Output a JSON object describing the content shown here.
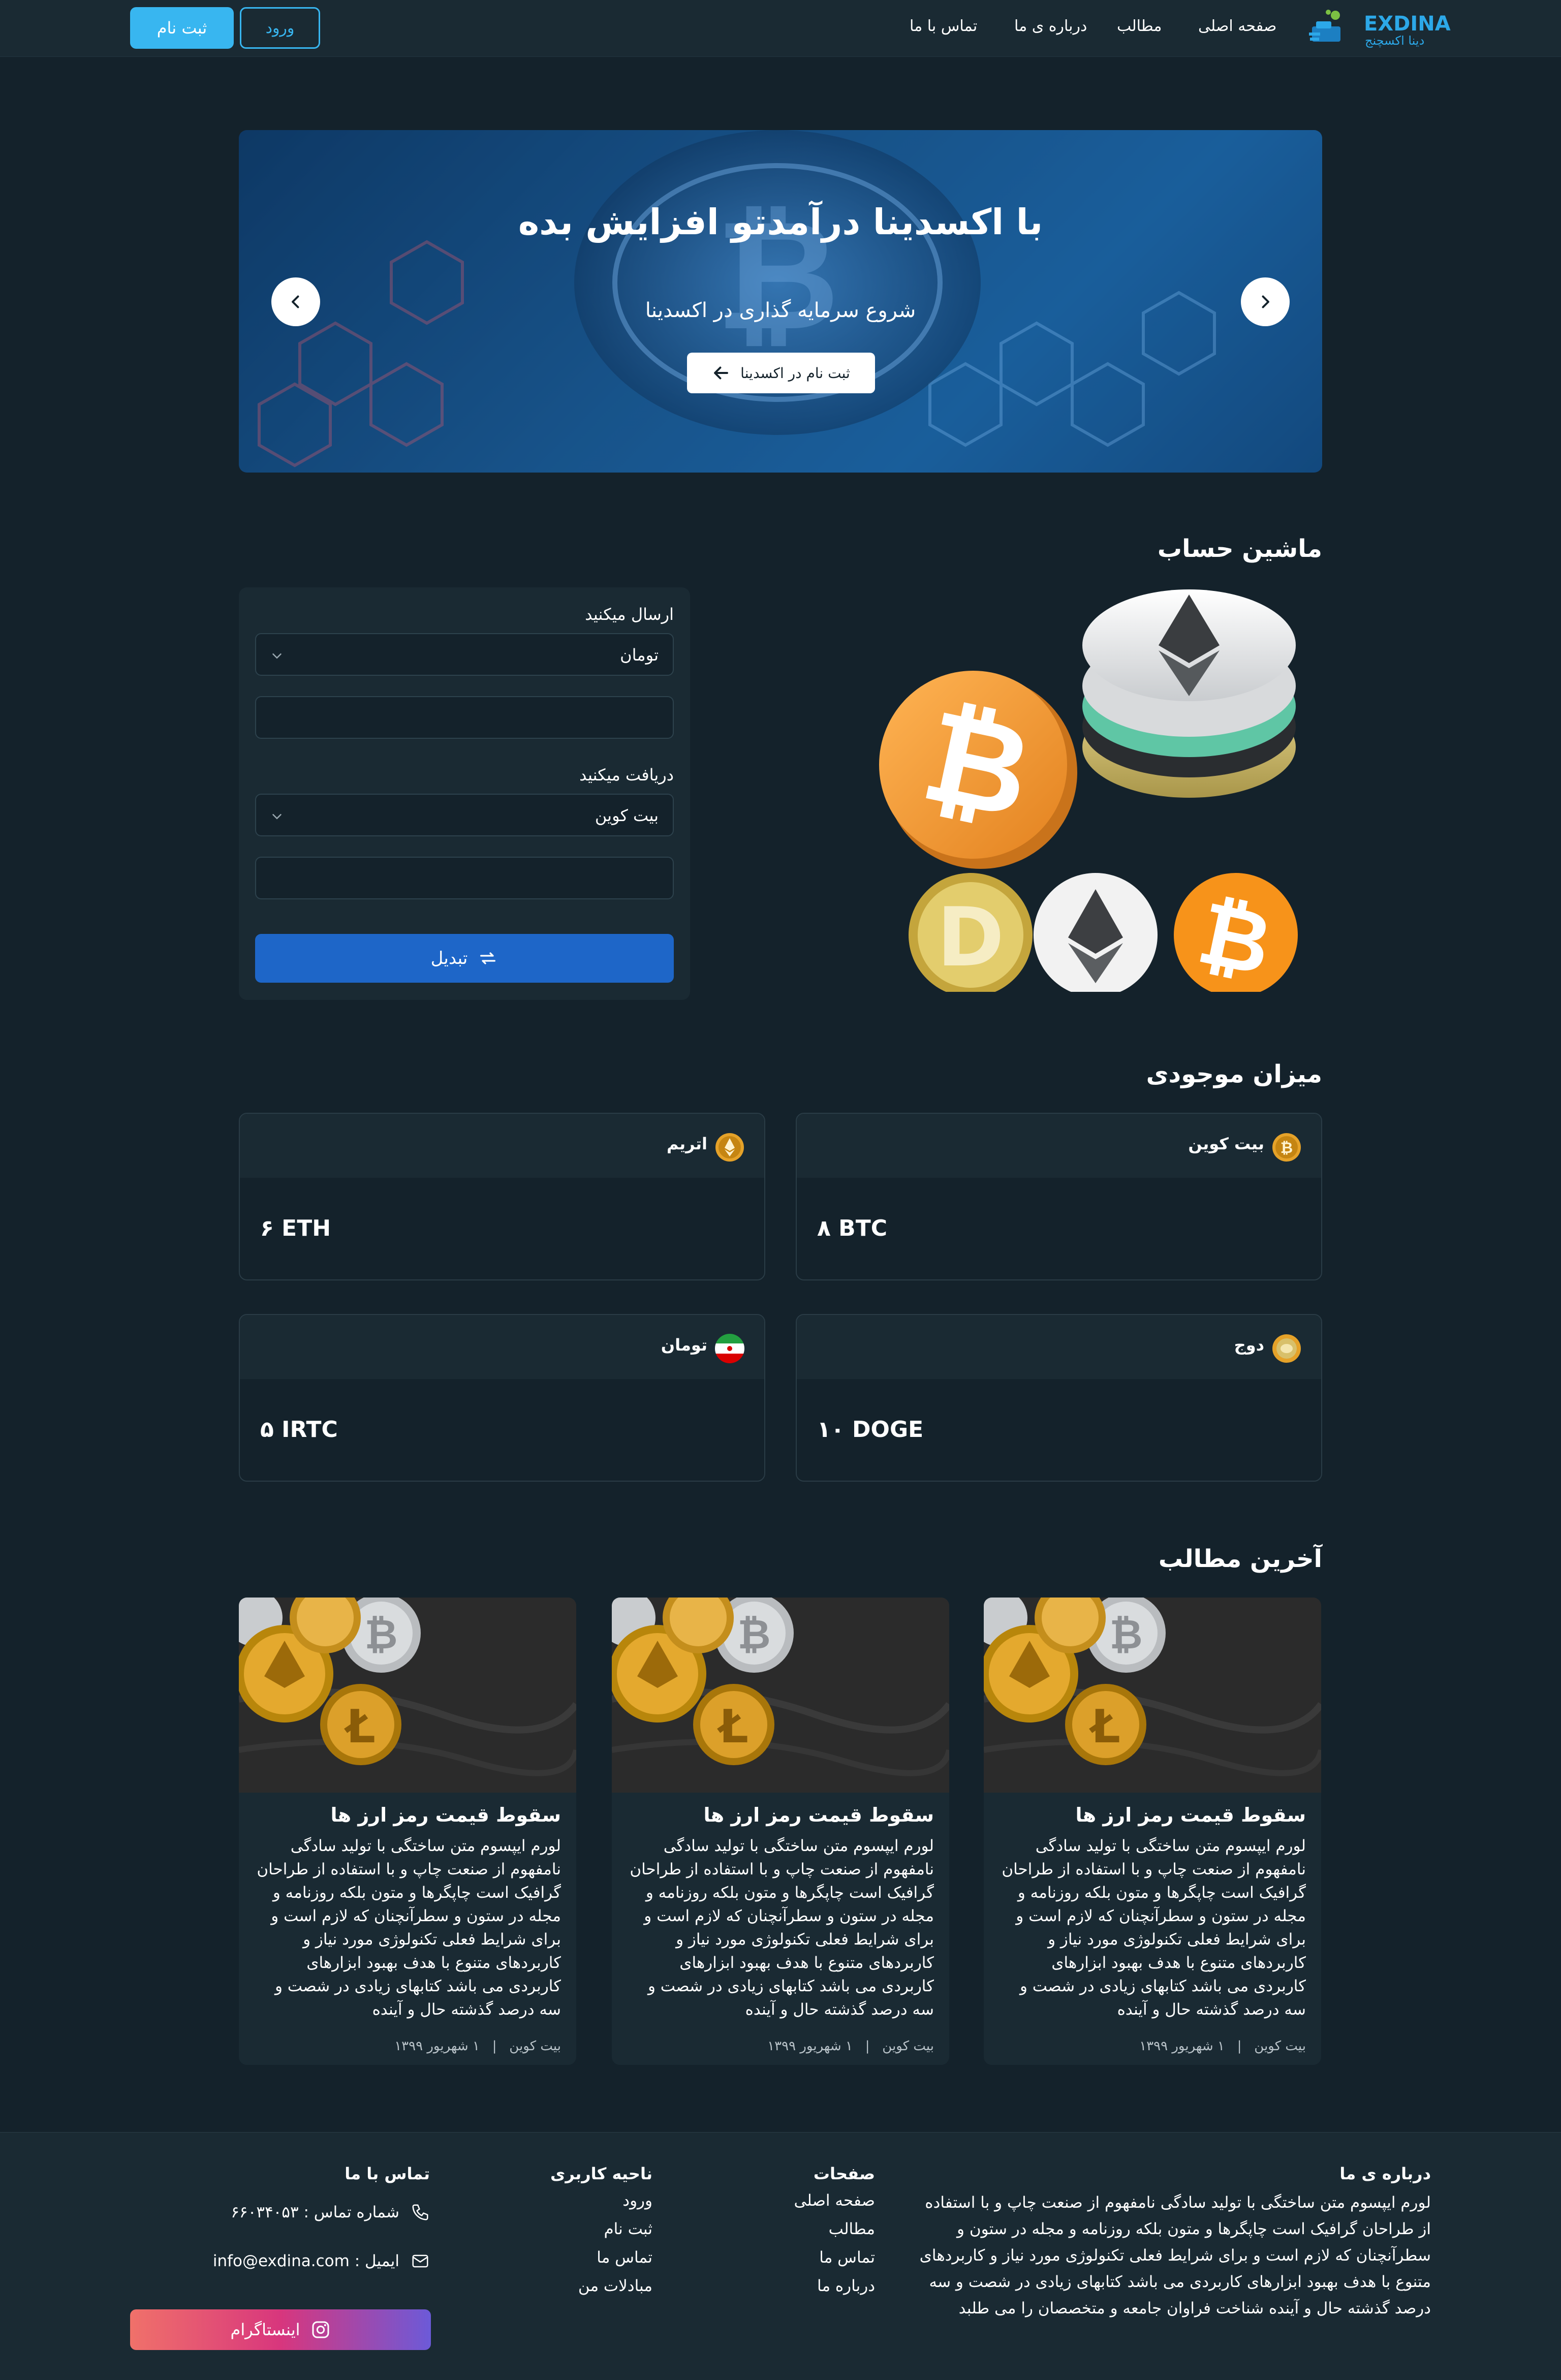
{
  "header": {
    "logo_text": "EXDINA",
    "logo_sub": "دینا اکسچنج",
    "nav": [
      "صفحه اصلی",
      "مطالب",
      "درباره ی ما",
      "تماس با ما"
    ],
    "login_label": "ورود",
    "signup_label": "ثبت نام"
  },
  "hero": {
    "title": "با اکسدینا درآمدتو افزایش بده",
    "subtitle": "شروع سرمایه گذاری در اکسدینا",
    "cta_label": "ثبت نام در اکسدینا"
  },
  "calculator": {
    "title": "ماشین حساب",
    "send_label": "ارسال میکنید",
    "send_value": "تومان",
    "send_amount": "",
    "receive_label": "دریافت میکنید",
    "receive_value": "بیت کوین",
    "receive_amount": "",
    "convert_label": "تبدیل"
  },
  "balances": {
    "title": "میزان موجودی",
    "items": [
      {
        "name": "بیت کوین",
        "amount": "۸ BTC"
      },
      {
        "name": "اتریم",
        "amount": "۶ ETH"
      },
      {
        "name": "دوج",
        "amount": "۱۰ DOGE"
      },
      {
        "name": "تومان",
        "amount": "۵ IRTC"
      }
    ]
  },
  "articles": {
    "title": "آخرین مطالب",
    "items": [
      {
        "title": "سقوط قیمت رمز ارز ها",
        "body": "لورم ایپسوم متن ساختگی با تولید سادگی نامفهوم از صنعت چاپ و با استفاده از طراحان گرافیک است چاپگرها و متون بلکه روزنامه و مجله در ستون و سطرآنچنان که لازم است و برای شرایط فعلی تکنولوژی مورد نیاز و کاربردهای متنوع با هدف بهبود ابزارهای کاربردی می باشد کتابهای زیادی در شصت و سه درصد گذشته حال و آینده",
        "category": "بیت کوین",
        "date": "۱ شهریور ۱۳۹۹"
      },
      {
        "title": "سقوط قیمت رمز ارز ها",
        "body": "لورم ایپسوم متن ساختگی با تولید سادگی نامفهوم از صنعت چاپ و با استفاده از طراحان گرافیک است چاپگرها و متون بلکه روزنامه و مجله در ستون و سطرآنچنان که لازم است و برای شرایط فعلی تکنولوژی مورد نیاز و کاربردهای متنوع با هدف بهبود ابزارهای کاربردی می باشد کتابهای زیادی در شصت و سه درصد گذشته حال و آینده",
        "category": "بیت کوین",
        "date": "۱ شهریور ۱۳۹۹"
      },
      {
        "title": "سقوط قیمت رمز ارز ها",
        "body": "لورم ایپسوم متن ساختگی با تولید سادگی نامفهوم از صنعت چاپ و با استفاده از طراحان گرافیک است چاپگرها و متون بلکه روزنامه و مجله در ستون و سطرآنچنان که لازم است و برای شرایط فعلی تکنولوژی مورد نیاز و کاربردهای متنوع با هدف بهبود ابزارهای کاربردی می باشد کتابهای زیادی در شصت و سه درصد گذشته حال و آینده",
        "category": "بیت کوین",
        "date": "۱ شهریور ۱۳۹۹"
      }
    ]
  },
  "footer": {
    "about_title": "درباره ی ما",
    "about_text": "لورم ایپسوم متن ساختگی با تولید سادگی نامفهوم از صنعت چاپ و با استفاده از طراحان گرافیک است چاپگرها و متون بلکه روزنامه و مجله در ستون و سطرآنچنان که لازم است و برای شرایط فعلی تکنولوژی مورد نیاز و کاربردهای متنوع با هدف بهبود ابزارهای کاربردی می باشد کتابهای زیادی در شصت و سه درصد گذشته حال و آینده شناخت فراوان جامعه و متخصصان را می طلبد",
    "pages_title": "صفحات",
    "pages": [
      "صفحه اصلی",
      "مطالب",
      "تماس ما",
      "درباره ما"
    ],
    "user_title": "ناحیه کاربری",
    "user_links": [
      "ورود",
      "ثبت نام",
      "تماس ما",
      "مبادلات من"
    ],
    "contact_title": "تماس با ما",
    "phone": "شماره تماس : ۶۶۰۳۴۰۵۳",
    "email": "ایمیل : info@exdina.com",
    "instagram_label": "اینستاگرام"
  },
  "colors": {
    "background": "#14222b",
    "card": "#1a2a33",
    "accent": "#38b6f0",
    "primary_button": "#1e66c8"
  }
}
